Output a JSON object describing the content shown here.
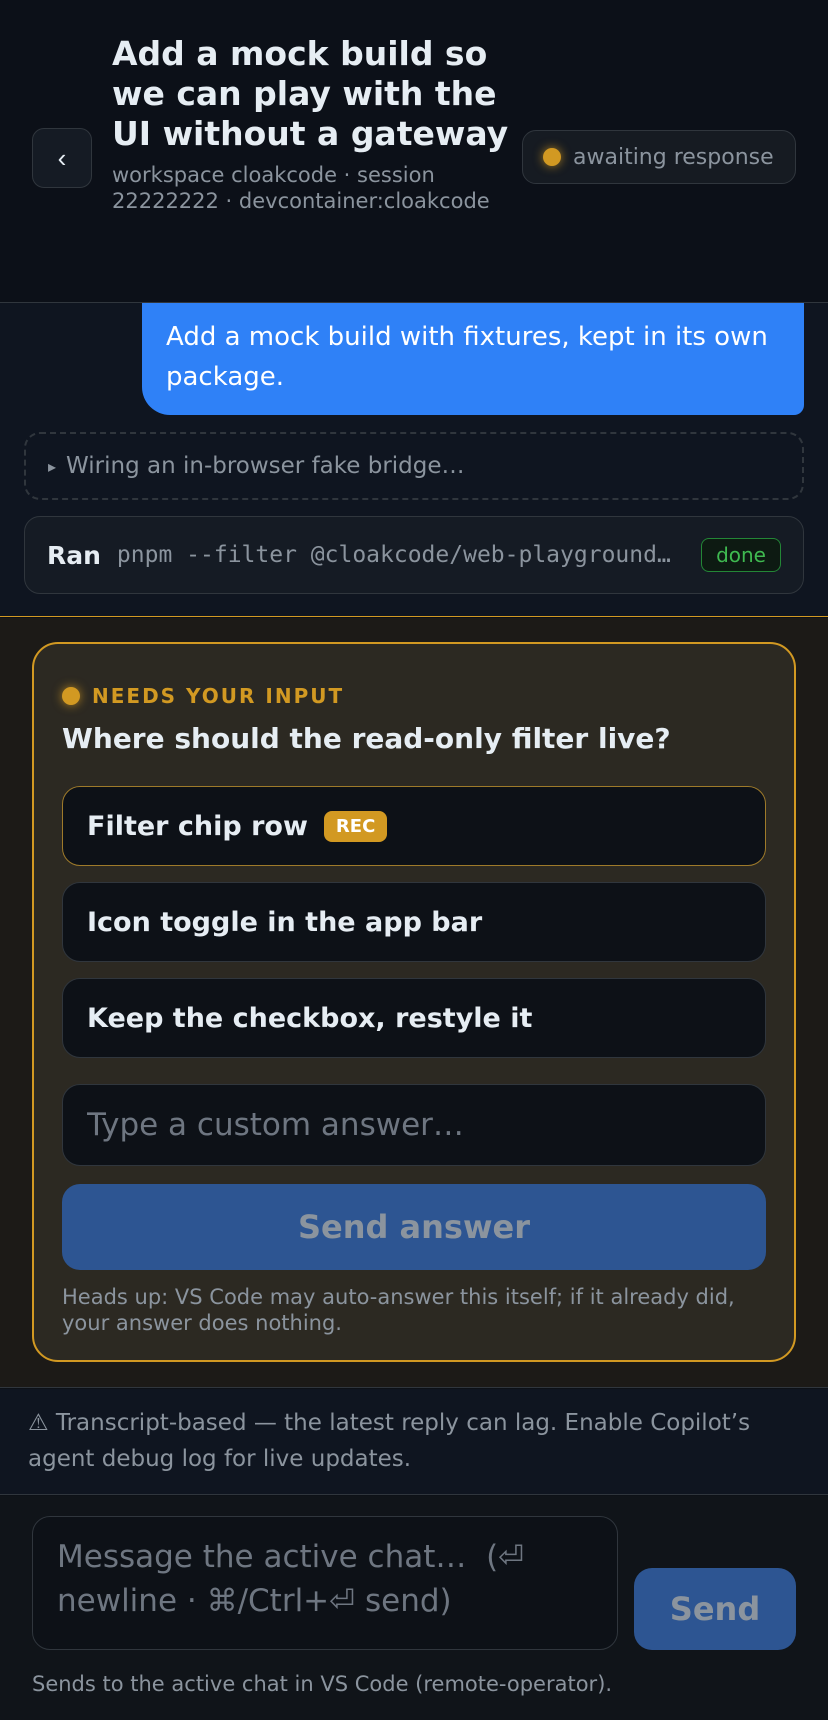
{
  "header": {
    "back_icon": "chevron-left-icon",
    "back_glyph": "‹",
    "title": "Add a mock build so we can play with the UI without a gateway",
    "subtitle": "workspace cloakcode · session 22222222 · devcontainer:cloakcode",
    "status": "awaiting response",
    "status_color": "#d29922"
  },
  "transcript": {
    "user_message": "Add a mock build with fixtures, kept in its own package.",
    "thinking": {
      "icon": "triangle-right-icon",
      "glyph": "▸",
      "text": "Wiring an in-browser fake bridge…"
    },
    "tool": {
      "label": "Ran",
      "command": "pnpm --filter @cloakcode/web-playground build",
      "status": "done"
    }
  },
  "prompt": {
    "eyebrow": "NEEDS YOUR INPUT",
    "question": "Where should the read-only filter live?",
    "options": [
      {
        "label": "Filter chip row",
        "badge": "REC"
      },
      {
        "label": "Icon toggle in the app bar"
      },
      {
        "label": "Keep the checkbox, restyle it"
      }
    ],
    "custom_placeholder": "Type a custom answer…",
    "send_label": "Send answer",
    "note": "Heads up: VS Code may auto-answer this itself; if it already did, your answer does nothing."
  },
  "warning": {
    "text": "⚠ Transcript-based — the latest reply can lag. Enable Copilot’s agent debug log for live updates."
  },
  "composer": {
    "placeholder": "Message the active chat…  (⏎ newline · ⌘/Ctrl+⏎ send)",
    "send_label": "Send",
    "footnote": "Sends to the active chat in VS Code (remote-operator)."
  },
  "colors": {
    "accent_blue": "#2f81f7",
    "warning_amber": "#d29922",
    "success_green": "#3fb950"
  }
}
